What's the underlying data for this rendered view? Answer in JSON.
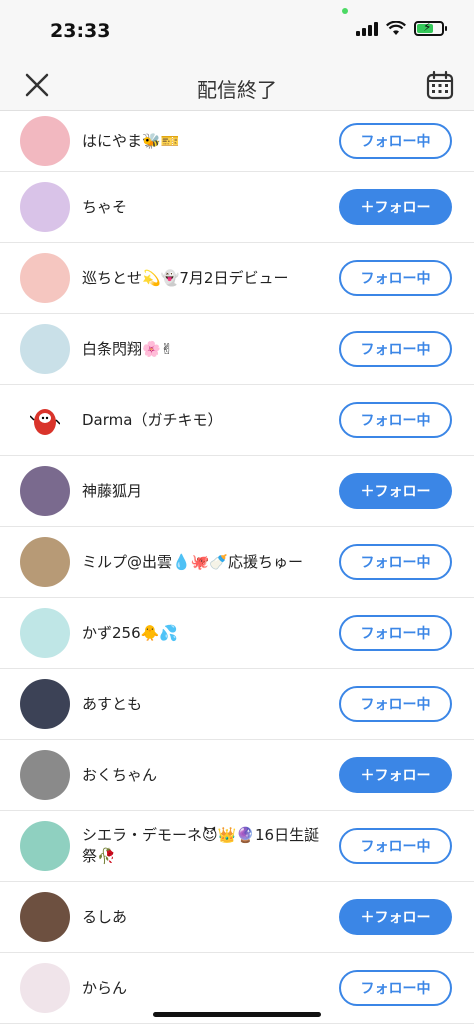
{
  "status_bar": {
    "time": "23:33"
  },
  "nav": {
    "title": "配信終了"
  },
  "users": [
    {
      "name": "はにやま🐝🎫",
      "button": "フォロー中",
      "following": true,
      "avatar_color": "#f2b8c0"
    },
    {
      "name": "ちゃそ",
      "button": "＋フォロー",
      "following": false,
      "avatar_color": "#d9c3e8"
    },
    {
      "name": "巡ちとせ💫👻7月2日デビュー",
      "button": "フォロー中",
      "following": true,
      "avatar_color": "#f5c6c0"
    },
    {
      "name": "白条閃翔🌸✌",
      "button": "フォロー中",
      "following": true,
      "avatar_color": "#c9e0e8"
    },
    {
      "name": "Darma（ガチキモ）",
      "button": "フォロー中",
      "following": true,
      "avatar_color": "#ffffff"
    },
    {
      "name": "神藤狐月",
      "button": "＋フォロー",
      "following": false,
      "avatar_color": "#7a6a8e"
    },
    {
      "name": "ミルプ@出雲💧🐙🍼応援ちゅー",
      "button": "フォロー中",
      "following": true,
      "avatar_color": "#b79a76"
    },
    {
      "name": "かず256🐥💦",
      "button": "フォロー中",
      "following": true,
      "avatar_color": "#bfe6e6"
    },
    {
      "name": "あすとも",
      "button": "フォロー中",
      "following": true,
      "avatar_color": "#3c4256"
    },
    {
      "name": "おくちゃん",
      "button": "＋フォロー",
      "following": false,
      "avatar_color": "#8a8a8a"
    },
    {
      "name": "シエラ・デモーネ😈👑🔮16日生誕祭🥀",
      "button": "フォロー中",
      "following": true,
      "avatar_color": "#8fd0c0"
    },
    {
      "name": "るしあ",
      "button": "＋フォロー",
      "following": false,
      "avatar_color": "#6d5040"
    },
    {
      "name": "からん",
      "button": "フォロー中",
      "following": true,
      "avatar_color": "#f0e4ea"
    }
  ]
}
